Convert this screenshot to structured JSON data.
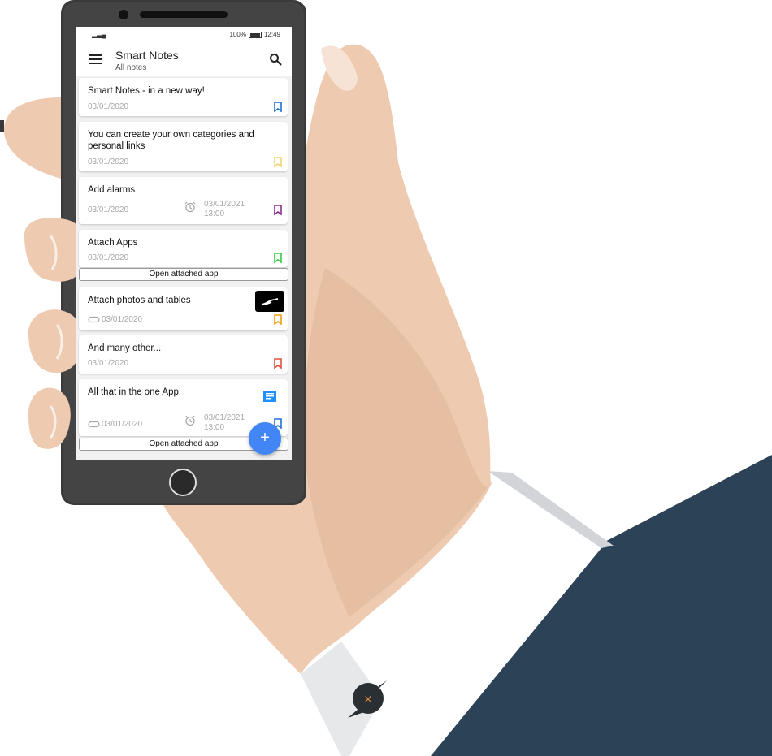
{
  "status": {
    "battery": "100%",
    "time": "12:49"
  },
  "app": {
    "title": "Smart Notes",
    "subtitle": "All notes"
  },
  "notes": [
    {
      "title": "Smart Notes - in a new way!",
      "date": "03/01/2020",
      "bookmark_color": "#1e6fd9"
    },
    {
      "title": "You can create your own categories and personal links",
      "date": "03/01/2020",
      "bookmark_color": "#f2d36b"
    },
    {
      "title": "Add alarms",
      "date": "03/01/2020",
      "alarm_date": "03/01/2021",
      "alarm_time": "13:00",
      "bookmark_color": "#8e2a8e"
    },
    {
      "title": "Attach Apps",
      "date": "03/01/2020",
      "bookmark_color": "#2ecc40",
      "button": "Open attached app"
    },
    {
      "title": "Attach photos and tables",
      "date": "03/01/2020",
      "bookmark_color": "#f39c12"
    },
    {
      "title": "And many other...",
      "date": "03/01/2020",
      "bookmark_color": "#e74c3c"
    },
    {
      "title": "All that in the one App!",
      "date": "03/01/2020",
      "alarm_date": "03/01/2021",
      "alarm_time": "13:00",
      "bookmark_color": "#1e6fd9",
      "button": "Open attached app"
    }
  ],
  "fab": {
    "label": "+"
  },
  "colors": {
    "skin": "#edcab0",
    "skin_shadow": "#e3b999",
    "sleeve": "#2b4257",
    "cuff": "#ffffff",
    "phone_frame": "#3a3a3a",
    "accent": "#4285f4"
  }
}
